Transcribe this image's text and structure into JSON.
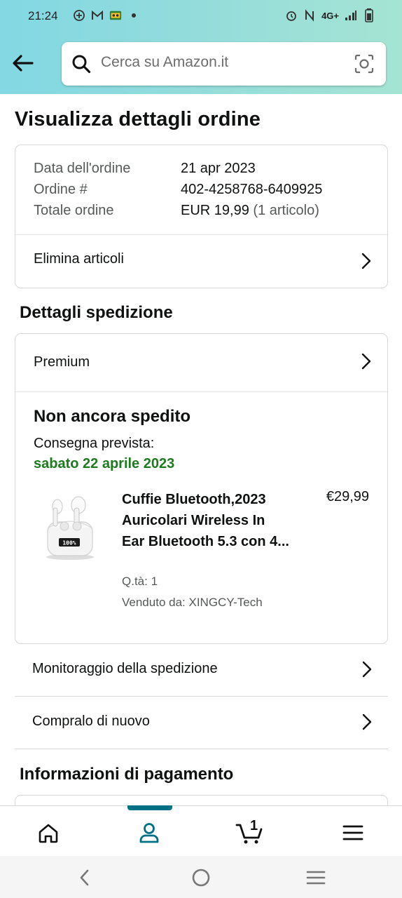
{
  "status_bar": {
    "time": "21:24",
    "network": "4G+"
  },
  "search": {
    "placeholder": "Cerca su Amazon.it"
  },
  "page": {
    "title": "Visualizza dettagli ordine"
  },
  "order_summary": {
    "date_label": "Data dell'ordine",
    "date_value": "21 apr 2023",
    "order_label": "Ordine #",
    "order_value": "402-4258768-6409925",
    "total_label": "Totale ordine",
    "total_value": "EUR 19,99",
    "total_items": "(1 articolo)",
    "delete_items": "Elimina articoli"
  },
  "shipping": {
    "section_title": "Dettagli spedizione",
    "shipping_type": "Premium",
    "status": "Non ancora spedito",
    "delivery_label": "Consegna prevista:",
    "delivery_date": "sabato 22 aprile 2023",
    "product": {
      "title": "Cuffie Bluetooth,2023 Auricolari Wireless In Ear Bluetooth 5.3 con 4...",
      "price": "€29,99",
      "quantity": "Q.tà: 1",
      "seller": "Venduto da: XINGCY-Tech",
      "case_display": "100%"
    },
    "track": "Monitoraggio della spedizione",
    "buy_again": "Compralo di nuovo"
  },
  "payment": {
    "section_title": "Informazioni di pagamento"
  },
  "bottom_nav": {
    "cart_count": "1"
  },
  "colors": {
    "header_gradient_start": "#82d8e3",
    "header_gradient_end": "#a5e4d3",
    "accent_teal": "#007185",
    "delivery_green": "#1e7a1e"
  },
  "icons": [
    "back-arrow-icon",
    "search-icon",
    "camera-lens-icon",
    "chevron-right-icon",
    "home-icon",
    "user-icon",
    "cart-icon",
    "menu-icon"
  ]
}
